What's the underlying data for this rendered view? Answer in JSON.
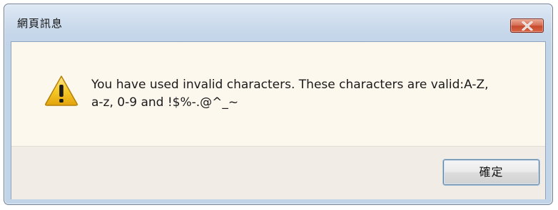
{
  "window": {
    "title": "網頁訊息"
  },
  "dialog": {
    "icon": "warning-icon",
    "message_line1": "You have used invalid characters. These characters are valid:A-Z,",
    "message_line2": "a-z, 0-9 and !$%-.@^_~",
    "ok_label": "確定",
    "close_icon": "close-icon"
  },
  "colors": {
    "close_button": "#d0553a",
    "content_background": "#fdf8ee",
    "warning_yellow": "#f2c21b"
  }
}
